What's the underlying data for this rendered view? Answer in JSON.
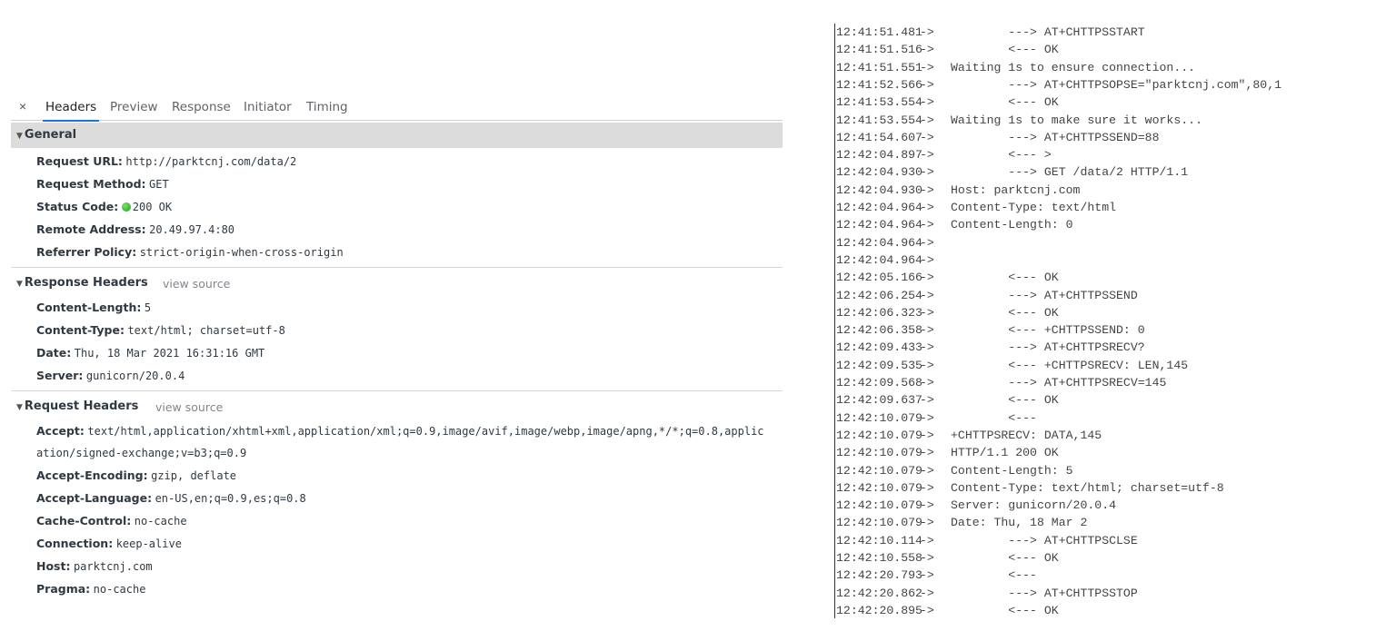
{
  "tabs": [
    "Headers",
    "Preview",
    "Response",
    "Initiator",
    "Timing"
  ],
  "close_label": "×",
  "general": {
    "title": "General",
    "rows": [
      {
        "k": "Request URL:",
        "v": "http://parktcnj.com/data/2"
      },
      {
        "k": "Request Method:",
        "v": "GET"
      },
      {
        "k": "Status Code:",
        "v": "200 OK"
      },
      {
        "k": "Remote Address:",
        "v": "20.49.97.4:80"
      },
      {
        "k": "Referrer Policy:",
        "v": "strict-origin-when-cross-origin"
      }
    ]
  },
  "response_headers": {
    "title": "Response Headers",
    "view_source": "view source",
    "rows": [
      {
        "k": "Content-Length:",
        "v": "5"
      },
      {
        "k": "Content-Type:",
        "v": "text/html; charset=utf-8"
      },
      {
        "k": "Date:",
        "v": "Thu, 18 Mar 2021 16:31:16 GMT"
      },
      {
        "k": "Server:",
        "v": "gunicorn/20.0.4"
      }
    ]
  },
  "request_headers": {
    "title": "Request Headers",
    "view_source": "view source",
    "accept_label": "Accept:",
    "accept_line1": "text/html,application/xhtml+xml,application/xml;q=0.9,image/avif,image/webp,image/apng,*/*;q=0.8,applic",
    "accept_line2": "ation/signed-exchange;v=b3;q=0.9",
    "rows": [
      {
        "k": "Accept-Encoding:",
        "v": "gzip, deflate"
      },
      {
        "k": "Accept-Language:",
        "v": "en-US,en;q=0.9,es;q=0.8"
      },
      {
        "k": "Cache-Control:",
        "v": "no-cache"
      },
      {
        "k": "Connection:",
        "v": "keep-alive"
      },
      {
        "k": "Host:",
        "v": "parktcnj.com"
      },
      {
        "k": "Pragma:",
        "v": "no-cache"
      }
    ]
  },
  "serial_log": [
    {
      "t": "12:41:51.481",
      "a": "->",
      "m": "        ---> AT+CHTTPSSTART"
    },
    {
      "t": "12:41:51.516",
      "a": "->",
      "m": "        <--- OK"
    },
    {
      "t": "12:41:51.551",
      "a": "->",
      "m": "Waiting 1s to ensure connection..."
    },
    {
      "t": "12:41:52.566",
      "a": "->",
      "m": "        ---> AT+CHTTPSOPSE=\"parktcnj.com\",80,1"
    },
    {
      "t": "12:41:53.554",
      "a": "->",
      "m": "        <--- OK"
    },
    {
      "t": "12:41:53.554",
      "a": "->",
      "m": "Waiting 1s to make sure it works..."
    },
    {
      "t": "12:41:54.607",
      "a": "->",
      "m": "        ---> AT+CHTTPSSEND=88"
    },
    {
      "t": "12:42:04.897",
      "a": "->",
      "m": "        <--- >"
    },
    {
      "t": "12:42:04.930",
      "a": "->",
      "m": "        ---> GET /data/2 HTTP/1.1"
    },
    {
      "t": "12:42:04.930",
      "a": "->",
      "m": "Host: parktcnj.com"
    },
    {
      "t": "12:42:04.964",
      "a": "->",
      "m": "Content-Type: text/html"
    },
    {
      "t": "12:42:04.964",
      "a": "->",
      "m": "Content-Length: 0"
    },
    {
      "t": "12:42:04.964",
      "a": "->",
      "m": ""
    },
    {
      "t": "12:42:04.964",
      "a": "->",
      "m": ""
    },
    {
      "t": "12:42:05.166",
      "a": "->",
      "m": "        <--- OK"
    },
    {
      "t": "12:42:06.254",
      "a": "->",
      "m": "        ---> AT+CHTTPSSEND"
    },
    {
      "t": "12:42:06.323",
      "a": "->",
      "m": "        <--- OK"
    },
    {
      "t": "12:42:06.358",
      "a": "->",
      "m": "        <--- +CHTTPSSEND: 0"
    },
    {
      "t": "12:42:09.433",
      "a": "->",
      "m": "        ---> AT+CHTTPSRECV?"
    },
    {
      "t": "12:42:09.535",
      "a": "->",
      "m": "        <--- +CHTTPSRECV: LEN,145"
    },
    {
      "t": "12:42:09.568",
      "a": "->",
      "m": "        ---> AT+CHTTPSRECV=145"
    },
    {
      "t": "12:42:09.637",
      "a": "->",
      "m": "        <--- OK"
    },
    {
      "t": "12:42:10.079",
      "a": "->",
      "m": "        <---"
    },
    {
      "t": "12:42:10.079",
      "a": "->",
      "m": "+CHTTPSRECV: DATA,145"
    },
    {
      "t": "12:42:10.079",
      "a": "->",
      "m": "HTTP/1.1 200 OK"
    },
    {
      "t": "12:42:10.079",
      "a": "->",
      "m": "Content-Length: 5"
    },
    {
      "t": "12:42:10.079",
      "a": "->",
      "m": "Content-Type: text/html; charset=utf-8"
    },
    {
      "t": "12:42:10.079",
      "a": "->",
      "m": "Server: gunicorn/20.0.4"
    },
    {
      "t": "12:42:10.079",
      "a": "->",
      "m": "Date: Thu, 18 Mar 2"
    },
    {
      "t": "12:42:10.114",
      "a": "->",
      "m": "        ---> AT+CHTTPSCLSE"
    },
    {
      "t": "12:42:10.558",
      "a": "->",
      "m": "        <--- OK"
    },
    {
      "t": "12:42:20.793",
      "a": "->",
      "m": "        <---"
    },
    {
      "t": "12:42:20.862",
      "a": "->",
      "m": "        ---> AT+CHTTPSSTOP"
    },
    {
      "t": "12:42:20.895",
      "a": "->",
      "m": "        <--- OK"
    }
  ],
  "colors": {
    "tab_active_underline": "#1a73e8",
    "status_ok": "#2fb21f",
    "general_header_bg": "#dcdcdc"
  },
  "icons": {
    "close": "close-icon",
    "status": "status-ok-dot-icon",
    "expand": "triangle-down-icon"
  }
}
